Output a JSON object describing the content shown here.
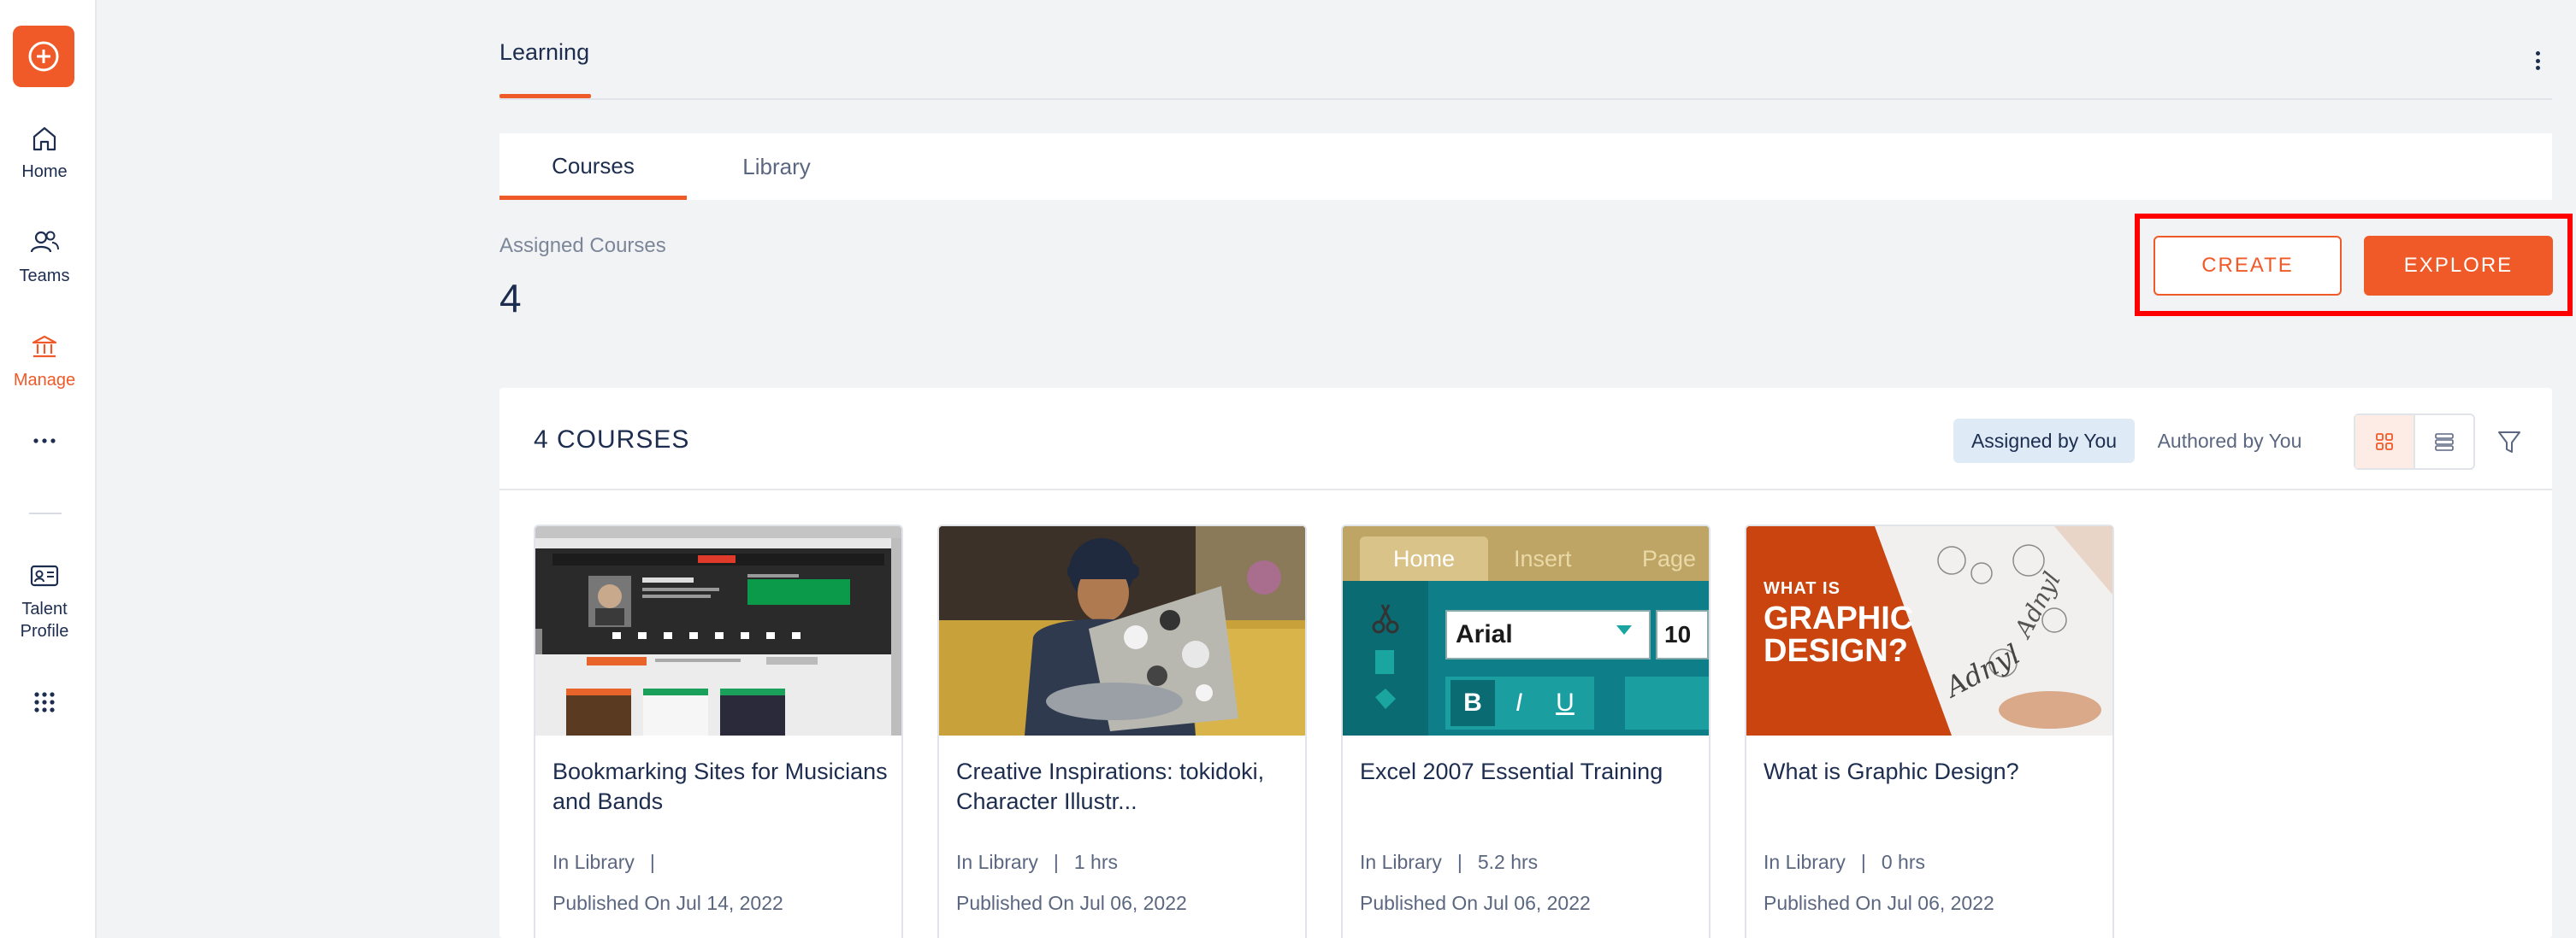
{
  "nav": {
    "items": [
      {
        "label": "Home",
        "icon": "home-icon"
      },
      {
        "label": "Teams",
        "icon": "teams-icon"
      },
      {
        "label": "Manage",
        "icon": "manage-icon"
      },
      {
        "label": "Talent Profile",
        "icon": "talent-profile-icon"
      }
    ]
  },
  "header": {
    "title": "Learning"
  },
  "tabs": [
    "Courses",
    "Library"
  ],
  "summary": {
    "label": "Assigned Courses",
    "count": "4"
  },
  "actions": {
    "create": "CREATE",
    "explore": "EXPLORE"
  },
  "panel": {
    "title": "4 COURSES",
    "filter_assigned": "Assigned by You",
    "filter_authored": "Authored by You"
  },
  "courses": [
    {
      "title": "Bookmarking Sites for Musicians and Bands",
      "status": "In Library",
      "sep": "|",
      "duration": "",
      "published": "Published On Jul 14, 2022"
    },
    {
      "title": "Creative Inspirations: tokidoki, Character Illustr...",
      "status": "In Library",
      "sep": "|",
      "duration": "1 hrs",
      "published": "Published On Jul 06, 2022"
    },
    {
      "title": "Excel 2007 Essential Training",
      "status": "In Library",
      "sep": "|",
      "duration": "5.2 hrs",
      "published": "Published On Jul 06, 2022"
    },
    {
      "title": "What is Graphic Design?",
      "status": "In Library",
      "sep": "|",
      "duration": "0 hrs",
      "published": "Published On Jul 06, 2022"
    }
  ],
  "thumbs": {
    "excel": {
      "tab_home": "Home",
      "tab_insert": "Insert",
      "tab_page": "Page",
      "font": "Arial",
      "size": "10",
      "bold": "B",
      "italic": "I",
      "underline": "U"
    },
    "graphic": {
      "line1": "WHAT IS",
      "line2": "GRAPHIC",
      "line3": "DESIGN?",
      "script1": "Adnyl",
      "script2": "Adnyl"
    }
  },
  "colors": {
    "accent": "#f05a28",
    "text": "#1d2d4f",
    "muted": "#5b6780",
    "highlight": "#ff0000"
  }
}
